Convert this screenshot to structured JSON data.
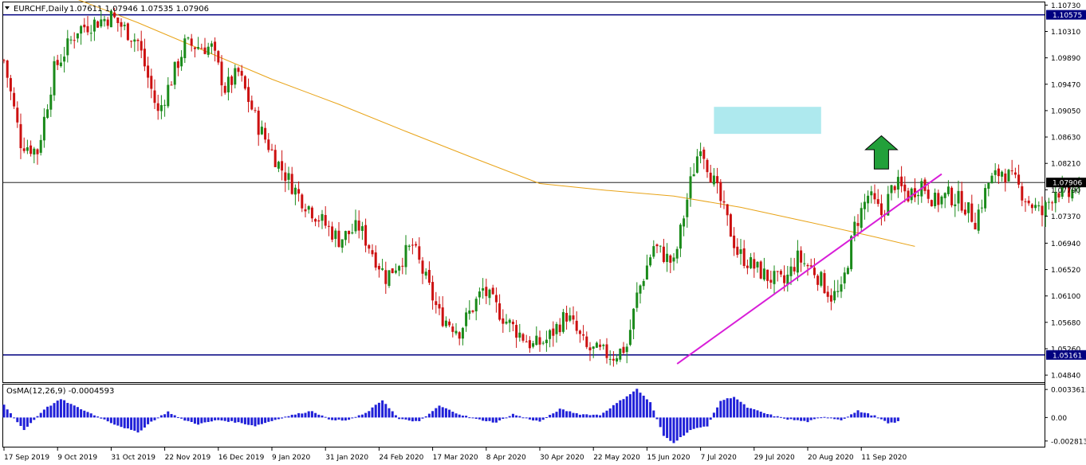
{
  "header": {
    "symbol": "EURCHF,Daily",
    "ohlc": "1.07611 1.07946 1.07535 1.07906"
  },
  "indicator": {
    "label": "OsMA(12,26,9) -0.0004593",
    "ticks": [
      "0.0033615",
      "0.00",
      "-0.0028134"
    ],
    "tick_values": [
      0.0033615,
      0.0,
      -0.0028134
    ]
  },
  "colors": {
    "bull": "#1a8a1a",
    "bear": "#cc1010",
    "ma": "#e8a317",
    "trendline": "#d81ed8",
    "hline": "#000080",
    "zone": "#aee9ee",
    "arrow": "#22a03a",
    "osma": "#2020d8"
  },
  "chart_data": {
    "type": "candlestick",
    "symbol": "EURCHF",
    "timeframe": "Daily",
    "ylim": [
      1.0474,
      1.0775
    ],
    "ylim_display": [
      1.0474,
      1.1076
    ],
    "price_ticks": [
      "1.10730",
      "1.10310",
      "1.09890",
      "1.09470",
      "1.09050",
      "1.08630",
      "1.08210",
      "1.07790",
      "1.07370",
      "1.06940",
      "1.06520",
      "1.06100",
      "1.05680",
      "1.05260",
      "1.04840"
    ],
    "price_tick_values": [
      1.1073,
      1.1031,
      1.0989,
      1.0947,
      1.0905,
      1.0863,
      1.0821,
      1.0779,
      1.0737,
      1.0694,
      1.0652,
      1.061,
      1.0568,
      1.0526,
      1.0484
    ],
    "date_labels": [
      "17 Sep 2019",
      "9 Oct 2019",
      "31 Oct 2019",
      "22 Nov 2019",
      "16 Dec 2019",
      "9 Jan 2020",
      "31 Jan 2020",
      "24 Feb 2020",
      "17 Mar 2020",
      "8 Apr 2020",
      "30 Apr 2020",
      "22 May 2020",
      "15 Jun 2020",
      "7 Jul 2020",
      "29 Jul 2020",
      "20 Aug 2020",
      "11 Sep 2020"
    ],
    "date_label_index": [
      0,
      16,
      32,
      48,
      64,
      80,
      96,
      112,
      128,
      144,
      160,
      176,
      192,
      208,
      224,
      240,
      256
    ],
    "current_price": {
      "label": "1.07906",
      "value": 1.07906
    },
    "horizontal_lines": [
      {
        "label": "1.10575",
        "value": 1.10575
      },
      {
        "label": "1.05161",
        "value": 1.05161
      }
    ],
    "resistance_zone": {
      "from_index": 212,
      "to_index": 244,
      "low": 1.0868,
      "high": 1.0911
    },
    "trendline": {
      "from_index": 201,
      "from_value": 1.0502,
      "to_index": 280,
      "to_value": 1.0804
    },
    "moving_average_path": [
      [
        0,
        1.1125
      ],
      [
        20,
        1.1086
      ],
      [
        40,
        1.1045
      ],
      [
        60,
        1.1
      ],
      [
        80,
        1.0955
      ],
      [
        100,
        1.0915
      ],
      [
        120,
        1.0872
      ],
      [
        140,
        1.083
      ],
      [
        160,
        1.0789
      ],
      [
        180,
        1.0778
      ],
      [
        200,
        1.0769
      ],
      [
        220,
        1.0751
      ],
      [
        240,
        1.0728
      ],
      [
        260,
        1.0704
      ],
      [
        272,
        1.0689
      ]
    ],
    "arrow": {
      "index": 262,
      "tip_value": 1.0865,
      "base_value": 1.0812,
      "direction": "up"
    },
    "price_path": [
      [
        0,
        1.0985
      ],
      [
        5,
        1.0855
      ],
      [
        10,
        1.084
      ],
      [
        15,
        1.097
      ],
      [
        22,
        1.1035
      ],
      [
        32,
        1.1055
      ],
      [
        40,
        1.1015
      ],
      [
        46,
        1.09
      ],
      [
        54,
        1.101
      ],
      [
        62,
        1.1005
      ],
      [
        66,
        1.094
      ],
      [
        70,
        1.0965
      ],
      [
        76,
        1.088
      ],
      [
        82,
        1.082
      ],
      [
        88,
        1.077
      ],
      [
        93,
        1.074
      ],
      [
        100,
        1.07
      ],
      [
        106,
        1.072
      ],
      [
        114,
        1.064
      ],
      [
        122,
        1.069
      ],
      [
        130,
        1.058
      ],
      [
        136,
        1.0555
      ],
      [
        143,
        1.062
      ],
      [
        150,
        1.057
      ],
      [
        158,
        1.053
      ],
      [
        162,
        1.054
      ],
      [
        168,
        1.058
      ],
      [
        174,
        1.0525
      ],
      [
        182,
        1.0515
      ],
      [
        186,
        1.053
      ],
      [
        189,
        1.061
      ],
      [
        194,
        1.069
      ],
      [
        200,
        1.066
      ],
      [
        205,
        1.079
      ],
      [
        208,
        1.0855
      ],
      [
        210,
        1.082
      ],
      [
        214,
        1.076
      ],
      [
        219,
        1.068
      ],
      [
        223,
        1.066
      ],
      [
        228,
        1.064
      ],
      [
        233,
        1.063
      ],
      [
        237,
        1.067
      ],
      [
        242,
        1.065
      ],
      [
        247,
        1.061
      ],
      [
        250,
        1.0615
      ],
      [
        254,
        1.072
      ],
      [
        258,
        1.077
      ],
      [
        262,
        1.074
      ],
      [
        266,
        1.079
      ],
      [
        270,
        1.077
      ],
      [
        274,
        1.079
      ],
      [
        278,
        1.076
      ],
      [
        282,
        1.077
      ],
      [
        286,
        1.076
      ],
      [
        290,
        1.073
      ],
      [
        294,
        1.079
      ],
      [
        298,
        1.081
      ],
      [
        302,
        1.079
      ],
      [
        306,
        1.076
      ],
      [
        310,
        1.074
      ],
      [
        314,
        1.078
      ],
      [
        318,
        1.077
      ],
      [
        321,
        1.0791
      ]
    ],
    "osma_path": [
      [
        0,
        0.0015
      ],
      [
        6,
        -0.0015
      ],
      [
        12,
        0.001
      ],
      [
        17,
        0.0022
      ],
      [
        22,
        0.0012
      ],
      [
        27,
        0.0003
      ],
      [
        33,
        -0.0008
      ],
      [
        40,
        -0.0018
      ],
      [
        44,
        -0.0005
      ],
      [
        49,
        0.0007
      ],
      [
        53,
        -0.0002
      ],
      [
        58,
        -0.0008
      ],
      [
        64,
        -0.0003
      ],
      [
        70,
        -0.0006
      ],
      [
        75,
        -0.001
      ],
      [
        80,
        -0.0004
      ],
      [
        85,
        0.0002
      ],
      [
        92,
        0.0008
      ],
      [
        97,
        -0.0002
      ],
      [
        102,
        -0.0004
      ],
      [
        108,
        0.0005
      ],
      [
        113,
        0.0021
      ],
      [
        118,
        -0.0002
      ],
      [
        124,
        -0.0005
      ],
      [
        130,
        0.0014
      ],
      [
        136,
        0.0004
      ],
      [
        141,
        -0.0002
      ],
      [
        147,
        -0.0006
      ],
      [
        152,
        0.0004
      ],
      [
        156,
        -0.0001
      ],
      [
        160,
        -0.0005
      ],
      [
        166,
        0.001
      ],
      [
        172,
        0.0004
      ],
      [
        178,
        0.0003
      ],
      [
        184,
        0.002
      ],
      [
        189,
        0.0034
      ],
      [
        193,
        0.0018
      ],
      [
        197,
        -0.0022
      ],
      [
        200,
        -0.003
      ],
      [
        205,
        -0.0015
      ],
      [
        210,
        -0.001
      ],
      [
        214,
        0.002
      ],
      [
        218,
        0.0025
      ],
      [
        222,
        0.0012
      ],
      [
        228,
        0.0004
      ],
      [
        234,
        -0.0002
      ],
      [
        240,
        -0.0005
      ],
      [
        245,
        0.0001
      ],
      [
        250,
        -0.0003
      ],
      [
        255,
        0.0008
      ],
      [
        260,
        0.0002
      ],
      [
        264,
        -0.0007
      ],
      [
        267,
        -0.0005
      ]
    ]
  }
}
